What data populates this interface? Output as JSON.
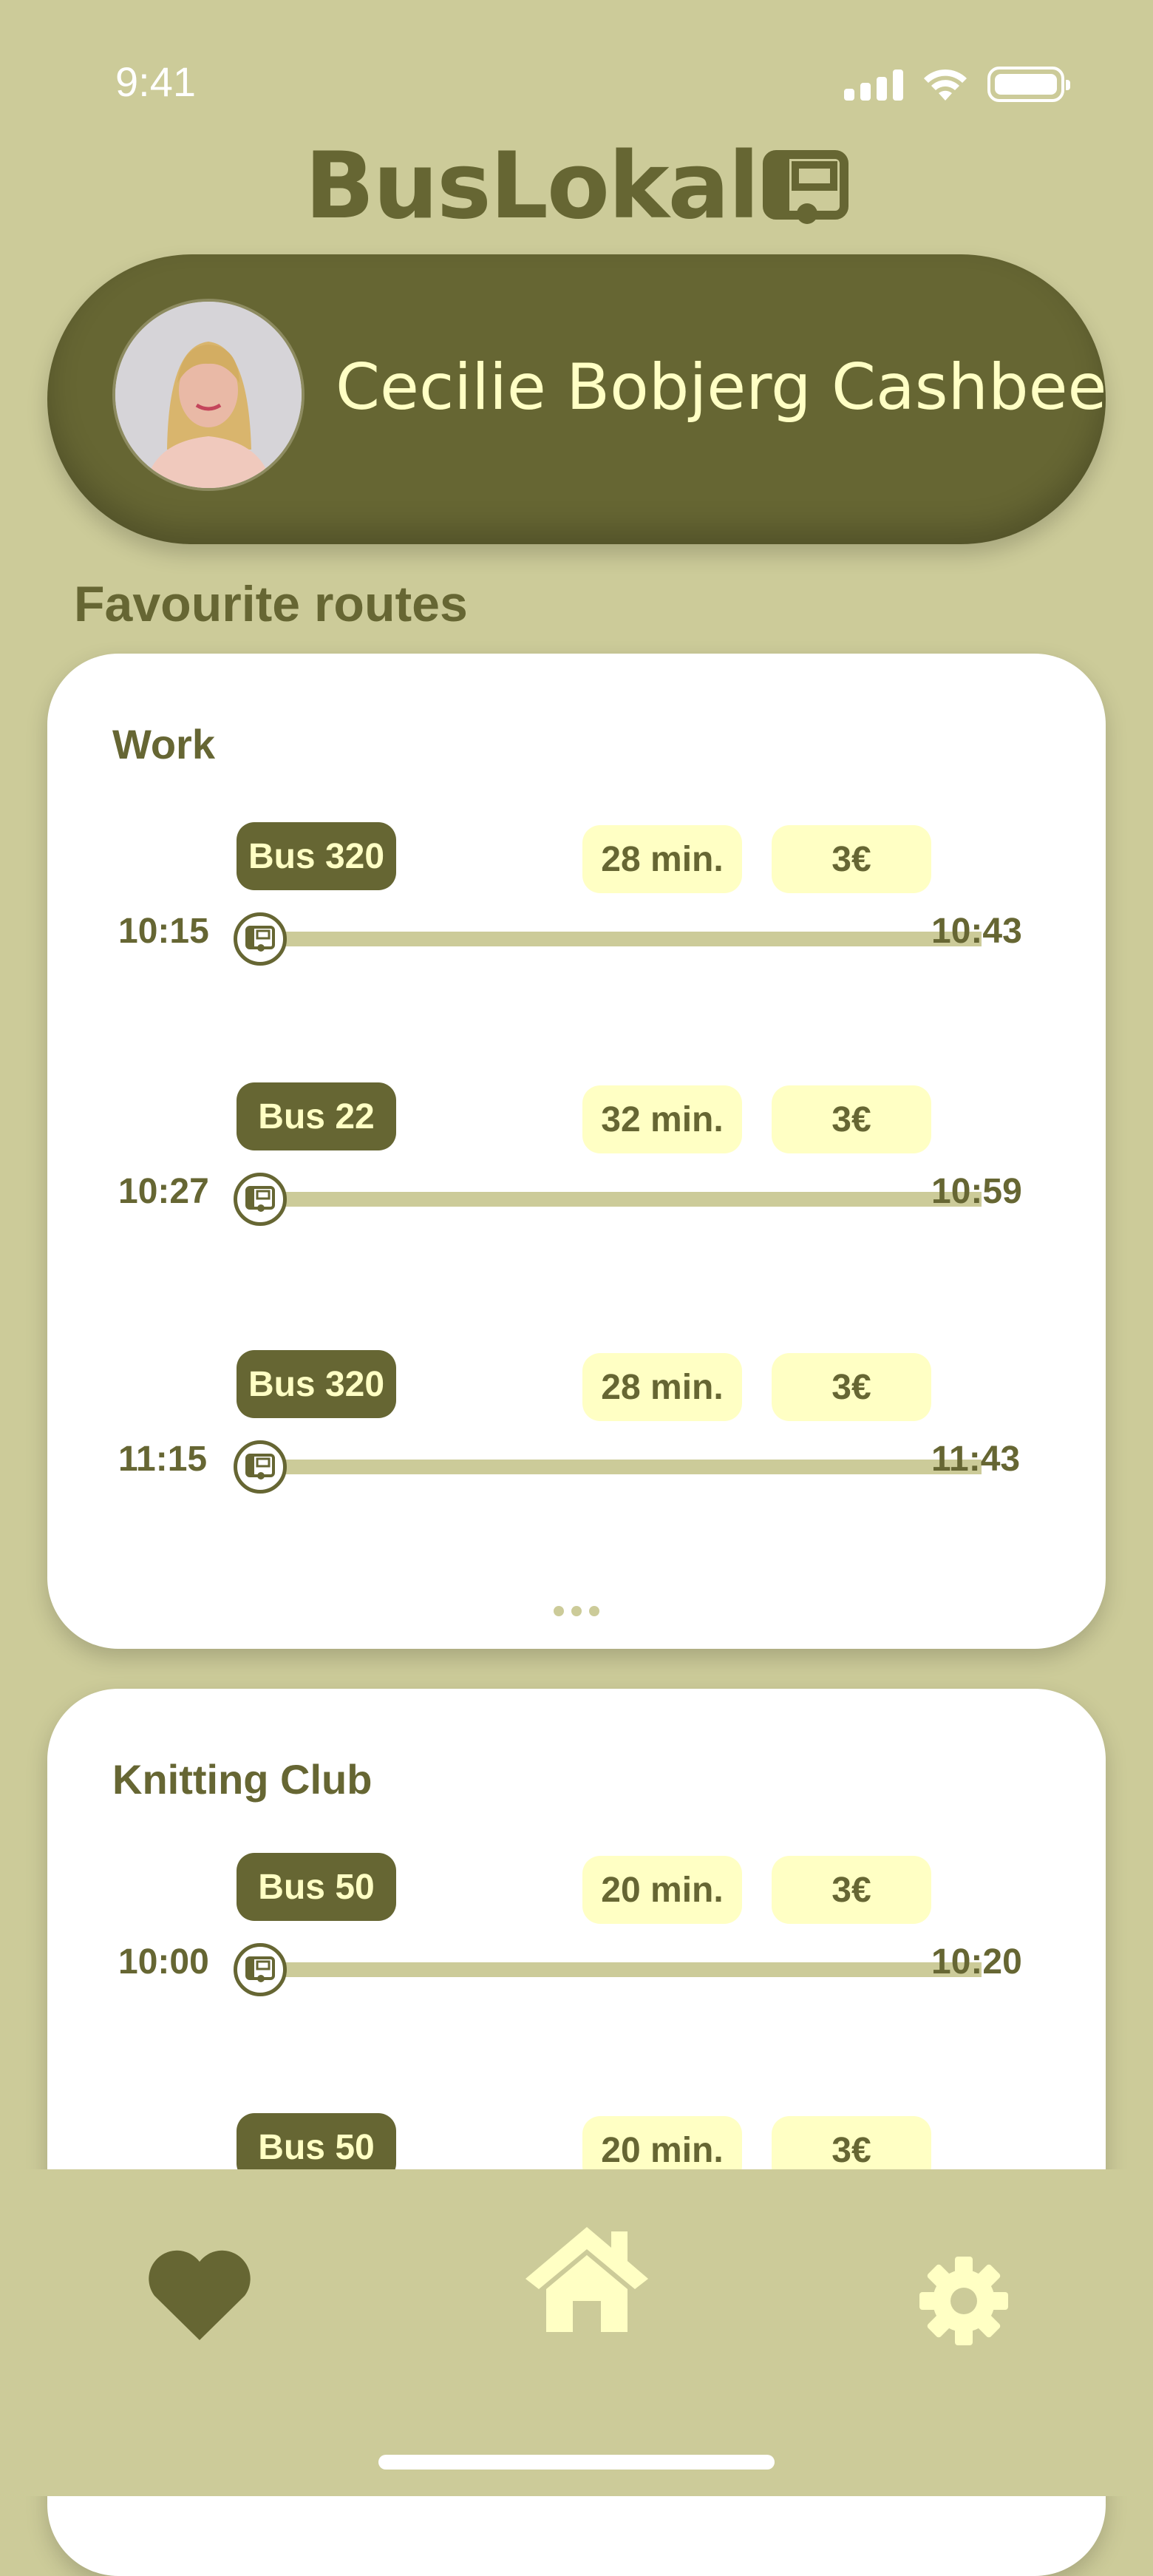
{
  "status": {
    "time": "9:41"
  },
  "app": {
    "title": "BusLokal"
  },
  "profile": {
    "name": "Cecilie Bobjerg Cashbee"
  },
  "section": {
    "title": "Favourite routes"
  },
  "favourites": [
    {
      "name": "Work",
      "routes": [
        {
          "bus": "Bus 320",
          "duration": "28 min.",
          "price": "3€",
          "depart": "10:15",
          "arrive": "10:43"
        },
        {
          "bus": "Bus 22",
          "duration": "32 min.",
          "price": "3€",
          "depart": "10:27",
          "arrive": "10:59"
        },
        {
          "bus": "Bus 320",
          "duration": "28 min.",
          "price": "3€",
          "depart": "11:15",
          "arrive": "11:43"
        }
      ]
    },
    {
      "name": "Knitting Club",
      "routes": [
        {
          "bus": "Bus 50",
          "duration": "20 min.",
          "price": "3€",
          "depart": "10:00",
          "arrive": "10:20"
        },
        {
          "bus": "Bus 50",
          "duration": "20 min.",
          "price": "3€",
          "depart": "",
          "arrive": ""
        }
      ]
    }
  ],
  "tabs": [
    {
      "icon": "heart-icon",
      "active": true
    },
    {
      "icon": "home-icon",
      "active": false
    },
    {
      "icon": "gear-icon",
      "active": false
    }
  ],
  "colors": {
    "background": "#cccb99",
    "primary": "#666633",
    "accent": "#ffffc4",
    "card": "#ffffff"
  }
}
